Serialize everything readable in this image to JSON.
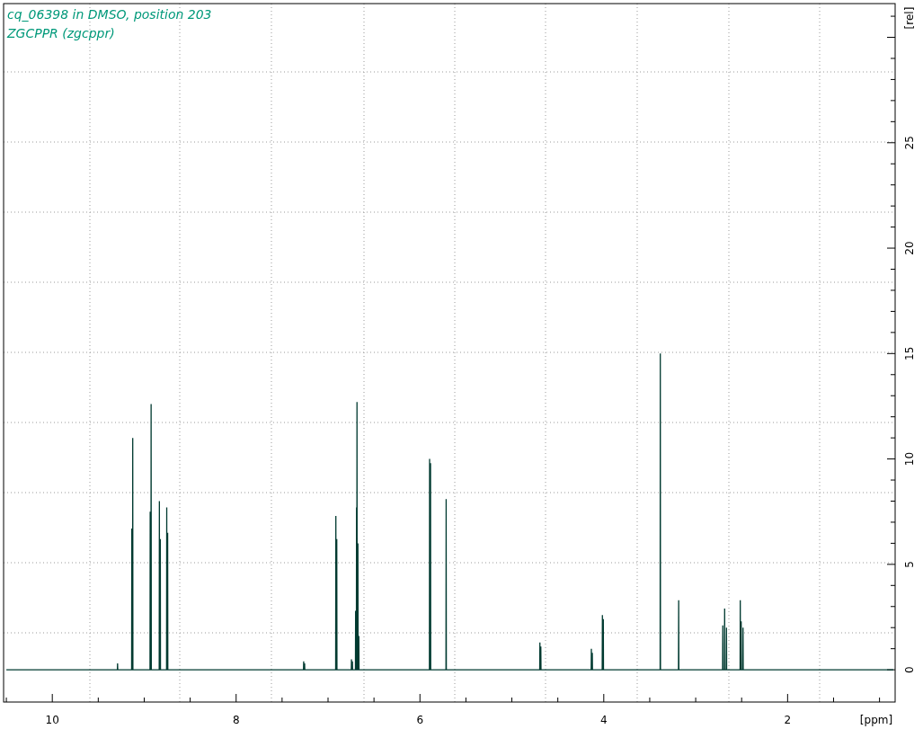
{
  "spectrum": {
    "labels": [
      "cq_06398 in DMSO, position 203",
      "ZGCPPR (zgcppr)"
    ],
    "chart_data": {
      "type": "line",
      "grid": true,
      "xlabel": "[ppm]",
      "ylabel": "[rel]",
      "xlim": [
        10.53,
        0.83
      ],
      "ylim": [
        -1.53,
        31.6
      ],
      "xticks": [
        10,
        8,
        6,
        4,
        2
      ],
      "yticks": [
        0,
        5,
        10,
        15,
        20,
        25
      ],
      "x": [
        10.5,
        9.292,
        9.29,
        9.288,
        9.137,
        9.135,
        9.133,
        9.127,
        9.125,
        9.123,
        8.937,
        8.935,
        8.933,
        8.927,
        8.925,
        8.923,
        8.837,
        8.835,
        8.833,
        8.827,
        8.825,
        8.823,
        8.757,
        8.755,
        8.753,
        8.747,
        8.745,
        8.743,
        7.267,
        7.265,
        7.263,
        7.257,
        7.255,
        7.253,
        6.917,
        6.915,
        6.913,
        6.907,
        6.905,
        6.903,
        6.747,
        6.745,
        6.743,
        6.737,
        6.735,
        6.733,
        6.702,
        6.7,
        6.698,
        6.692,
        6.69,
        6.688,
        6.687,
        6.685,
        6.683,
        6.677,
        6.675,
        6.673,
        6.667,
        6.665,
        6.663,
        5.897,
        5.895,
        5.893,
        5.887,
        5.885,
        5.883,
        5.717,
        5.715,
        5.713,
        4.697,
        4.695,
        4.693,
        4.687,
        4.685,
        4.683,
        4.137,
        4.135,
        4.133,
        4.127,
        4.125,
        4.123,
        4.017,
        4.015,
        4.013,
        4.007,
        4.005,
        4.003,
        3.387,
        3.385,
        3.383,
        3.187,
        3.185,
        3.183,
        2.707,
        2.705,
        2.703,
        2.687,
        2.685,
        2.683,
        2.667,
        2.665,
        2.663,
        2.517,
        2.515,
        2.513,
        2.507,
        2.505,
        2.503,
        2.487,
        2.485,
        2.483,
        0.85
      ],
      "series": [
        {
          "color": "#003a30",
          "values": [
            0,
            0,
            0.3,
            0,
            0,
            6.7,
            0,
            0,
            11.0,
            0,
            0,
            7.5,
            0,
            0,
            12.6,
            0,
            0,
            8.0,
            0,
            0,
            6.2,
            0,
            0,
            7.7,
            0,
            0,
            6.5,
            0,
            0,
            0.4,
            0,
            0,
            0.3,
            0,
            0,
            7.3,
            0,
            0,
            6.2,
            0,
            0,
            0.5,
            0,
            0,
            0.4,
            0,
            0,
            2.8,
            0,
            0,
            7.7,
            0,
            0,
            12.7,
            0,
            0,
            6.0,
            0,
            0,
            1.6,
            0,
            0,
            10.0,
            0,
            0,
            9.8,
            0,
            0,
            8.1,
            0,
            0,
            1.3,
            0,
            0,
            1.1,
            0,
            0,
            1.0,
            0,
            0,
            0.8,
            0,
            0,
            2.6,
            0,
            0,
            2.4,
            0,
            0,
            15.0,
            0,
            0,
            3.3,
            0,
            0,
            2.1,
            0,
            0,
            2.9,
            0,
            0,
            2.0,
            0,
            0,
            3.3,
            0,
            0,
            2.3,
            0,
            0,
            2.0,
            0,
            0
          ]
        }
      ]
    }
  }
}
